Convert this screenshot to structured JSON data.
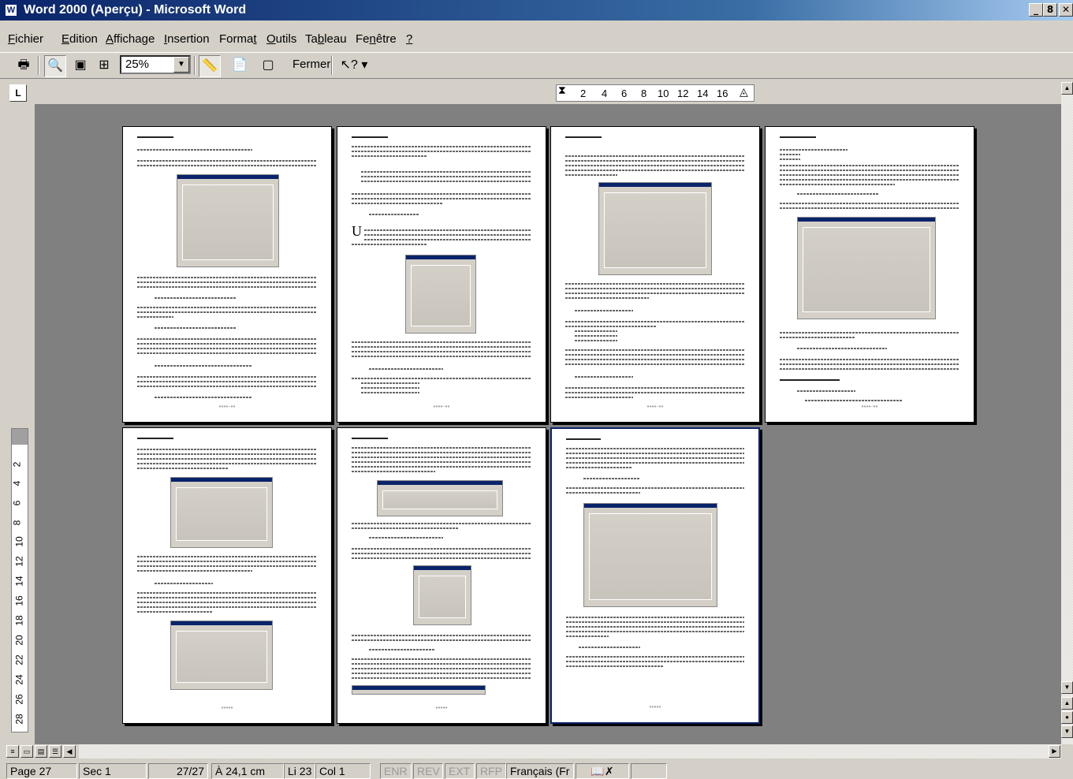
{
  "window": {
    "title": "Word 2000 (Aperçu) - Microsoft Word",
    "min": "_",
    "max": "8",
    "close": "✕"
  },
  "menu": [
    {
      "pre": "",
      "u": "F",
      "post": "ichier"
    },
    {
      "pre": "",
      "u": "E",
      "post": "dition"
    },
    {
      "pre": "",
      "u": "A",
      "post": "ffichage"
    },
    {
      "pre": "",
      "u": "I",
      "post": "nsertion"
    },
    {
      "pre": "Forma",
      "u": "t",
      "post": ""
    },
    {
      "pre": "",
      "u": "O",
      "post": "utils"
    },
    {
      "pre": "Ta",
      "u": "b",
      "post": "leau"
    },
    {
      "pre": "Fe",
      "u": "n",
      "post": "être"
    },
    {
      "pre": "",
      "u": "?",
      "post": ""
    }
  ],
  "toolbar": {
    "zoom": "25%",
    "close_label": "Fermer",
    "icons": [
      "print-icon",
      "magnifier-icon",
      "one-page-icon",
      "multiple-pages-icon",
      "view-ruler-icon",
      "shrink-to-fit-icon",
      "full-screen-icon",
      "help-icon"
    ]
  },
  "ruler": {
    "marks": [
      "2",
      "4",
      "6",
      "8",
      "10",
      "12",
      "14",
      "16"
    ],
    "vmarks": [
      "2",
      "4",
      "6",
      "8",
      "10",
      "12",
      "14",
      "16",
      "18",
      "20",
      "22",
      "24",
      "26",
      "28"
    ]
  },
  "pages": {
    "footers": [
      "»»»»-««",
      "»»»»-««",
      "»»»»-««",
      "»»»»-««",
      "«««»»",
      "«««»»",
      "«««»»"
    ]
  },
  "status": {
    "page": "Page 27",
    "sec": "Sec 1",
    "count": "27/27",
    "pos": "À 24,1 cm",
    "line": "Li 23",
    "col": "Col 1",
    "rec": "ENR",
    "rev": "REV",
    "ext": "EXT",
    "rfp": "RFP",
    "lang": "Français (Fr"
  }
}
